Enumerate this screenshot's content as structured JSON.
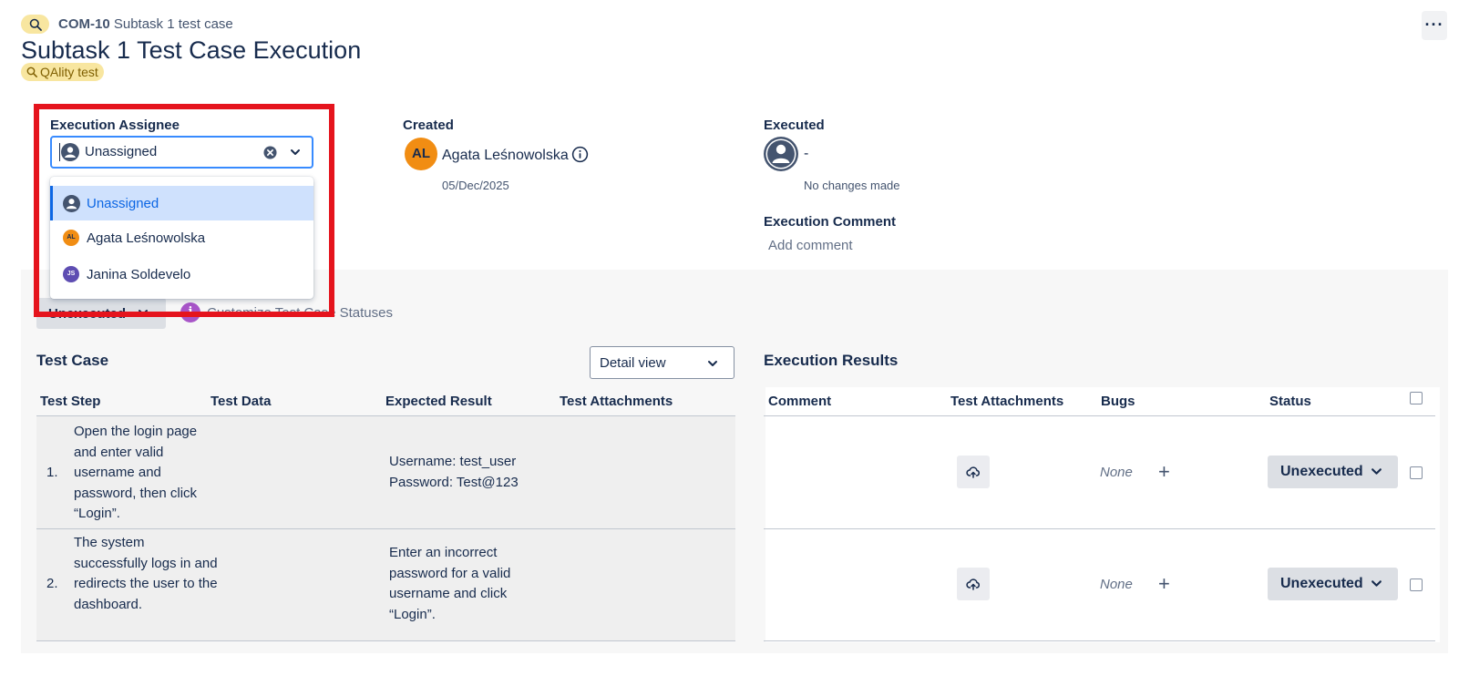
{
  "header": {
    "issue_key": "COM-10",
    "issue_summary": "Subtask 1 test case",
    "more_label": "···",
    "title": "Subtask 1 Test Case Execution",
    "app_badge": "QAlity test"
  },
  "assignee": {
    "label": "Execution Assignee",
    "value": "Unassigned",
    "options": [
      {
        "label": "Unassigned",
        "selected": true
      },
      {
        "label": "Agata Leśnowolska",
        "initials": "AL",
        "color": "#f18d13"
      },
      {
        "label": "Janina Soldevelo",
        "initials": "JS",
        "color": "#5e4db2"
      }
    ]
  },
  "created": {
    "label": "Created",
    "initials": "AL",
    "name": "Agata Leśnowolska",
    "date": "05/Dec/2025"
  },
  "executed": {
    "label": "Executed",
    "value": "-",
    "note": "No changes made"
  },
  "comment": {
    "label": "Execution Comment",
    "placeholder": "Add comment"
  },
  "status_bar": {
    "status": "Unexecuted",
    "info_icon": "i",
    "customize_link": "Customize Test Case Statuses"
  },
  "test_case": {
    "title": "Test Case",
    "view_select": "Detail view",
    "columns": [
      "Test Step",
      "Test Data",
      "Expected Result",
      "Test Attachments"
    ],
    "rows": [
      {
        "num": "1.",
        "step": "Open the login page and enter valid username and password, then click “Login”.",
        "data": "",
        "expected": "Username: test_user Password: Test@123"
      },
      {
        "num": "2.",
        "step": "The system successfully logs in and redirects the user to the dashboard.",
        "data": "",
        "expected": "Enter an incorrect password for a valid username and click “Login”."
      }
    ]
  },
  "execution_results": {
    "title": "Execution Results",
    "columns": [
      "Comment",
      "Test Attachments",
      "Bugs",
      "Status"
    ],
    "rows": [
      {
        "bugs": "None",
        "plus": "+",
        "status": "Unexecuted"
      },
      {
        "bugs": "None",
        "plus": "+",
        "status": "Unexecuted"
      }
    ]
  },
  "colors": {
    "accent": "#0c66e4",
    "highlight_border": "#e5141d",
    "badge_bg": "#f8e6a0",
    "panel_bg": "#f7f7f7"
  },
  "icons": {
    "issue": "magnifier-icon",
    "clear": "clear-icon",
    "dropdown": "chevron-down-icon",
    "upload": "cloud-upload-icon",
    "info": "info-icon"
  }
}
